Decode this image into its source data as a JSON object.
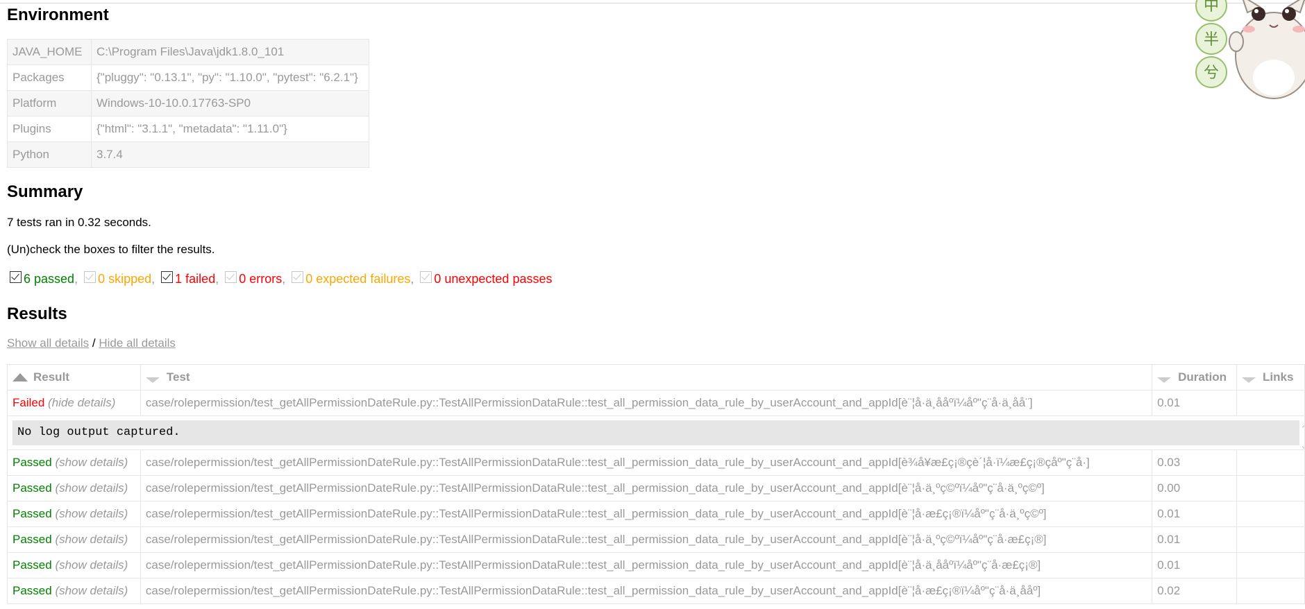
{
  "environment": {
    "title": "Environment",
    "rows": [
      {
        "key": "JAVA_HOME",
        "value": "C:\\Program Files\\Java\\jdk1.8.0_101"
      },
      {
        "key": "Packages",
        "value": "{\"pluggy\": \"0.13.1\", \"py\": \"1.10.0\", \"pytest\": \"6.2.1\"}"
      },
      {
        "key": "Platform",
        "value": "Windows-10-10.0.17763-SP0"
      },
      {
        "key": "Plugins",
        "value": "{\"html\": \"3.1.1\", \"metadata\": \"1.11.0\"}"
      },
      {
        "key": "Python",
        "value": "3.7.4"
      }
    ]
  },
  "summary": {
    "title": "Summary",
    "ran_text": "7 tests ran in 0.32 seconds.",
    "filter_hint": "(Un)check the boxes to filter the results.",
    "filters": [
      {
        "label": "6 passed",
        "checked": true,
        "enabled": true,
        "color": "#008000"
      },
      {
        "label": "0 skipped",
        "checked": true,
        "enabled": false,
        "color": "#ffa500"
      },
      {
        "label": "1 failed",
        "checked": true,
        "enabled": true,
        "color": "#ff0000"
      },
      {
        "label": "0 errors",
        "checked": true,
        "enabled": false,
        "color": "#ff0000"
      },
      {
        "label": "0 expected failures",
        "checked": true,
        "enabled": false,
        "color": "#ffa500"
      },
      {
        "label": "0 unexpected passes",
        "checked": true,
        "enabled": false,
        "color": "#ff0000"
      }
    ],
    "separator": ","
  },
  "results": {
    "title": "Results",
    "show_all": "Show all details",
    "slash": "/",
    "hide_all": "Hide all details",
    "columns": {
      "result": "Result",
      "test": "Test",
      "duration": "Duration",
      "links": "Links"
    },
    "log_text": "No log output captured.",
    "rows": [
      {
        "result": "Failed",
        "toggle": "(hide details)",
        "test": "case/rolepermission/test_getAllPermissionDateRule.py::TestAllPermissionDataRule::test_all_permission_data_rule_by_userAccount_and_appId[è¨¦å·ä¸ååºï¼åº\"ç¨å·ä¸åå¨]",
        "duration": "0.01"
      },
      {
        "result": "Passed",
        "toggle": "(show details)",
        "test": "case/rolepermission/test_getAllPermissionDateRule.py::TestAllPermissionDataRule::test_all_permission_data_rule_by_userAccount_and_appId[è¾å¥æ£ç¡®çè´¦å·ï¼æ£ç¡®çåº\"ç¨å·]",
        "duration": "0.03"
      },
      {
        "result": "Passed",
        "toggle": "(show details)",
        "test": "case/rolepermission/test_getAllPermissionDateRule.py::TestAllPermissionDataRule::test_all_permission_data_rule_by_userAccount_and_appId[è¨¦å·ä¸ºç©ºï¼åº\"ç¨å·ä¸ºç©º]",
        "duration": "0.00"
      },
      {
        "result": "Passed",
        "toggle": "(show details)",
        "test": "case/rolepermission/test_getAllPermissionDateRule.py::TestAllPermissionDataRule::test_all_permission_data_rule_by_userAccount_and_appId[è¨¦å·æ£ç¡®ï¼åº\"ç¨å·ä¸ºç©º]",
        "duration": "0.01"
      },
      {
        "result": "Passed",
        "toggle": "(show details)",
        "test": "case/rolepermission/test_getAllPermissionDateRule.py::TestAllPermissionDataRule::test_all_permission_data_rule_by_userAccount_and_appId[è¨¦å·ä¸ºç©ºï¼åº\"ç¨å·æ£ç¡®]",
        "duration": "0.01"
      },
      {
        "result": "Passed",
        "toggle": "(show details)",
        "test": "case/rolepermission/test_getAllPermissionDateRule.py::TestAllPermissionDataRule::test_all_permission_data_rule_by_userAccount_and_appId[è¨¦å·ä¸ååºï¼åº\"ç¨å·æ£ç¡®]",
        "duration": "0.01"
      },
      {
        "result": "Passed",
        "toggle": "(show details)",
        "test": "case/rolepermission/test_getAllPermissionDateRule.py::TestAllPermissionDataRule::test_all_permission_data_rule_by_userAccount_and_appId[è¨¦å·æ£ç¡®ï¼åº\"ç¨å·ä¸ååº]",
        "duration": "0.02"
      }
    ]
  },
  "mascot": {
    "icon": "cat-mascot-icon",
    "badge_glyphs": [
      "中",
      "半",
      "兮"
    ]
  },
  "colors": {
    "passed": "#008000",
    "failed": "#ff0000",
    "skipped": "#ffa500",
    "muted": "#999999"
  }
}
